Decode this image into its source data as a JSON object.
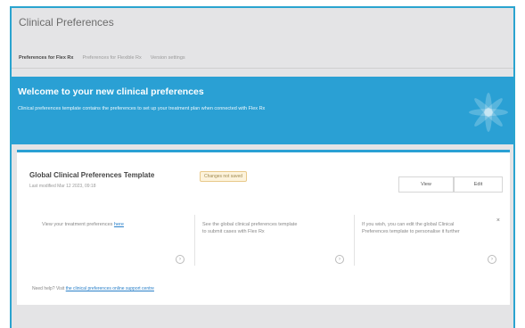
{
  "app": {
    "title": "Clinical Preferences"
  },
  "tabs": [
    {
      "label": "Preferences for Flex Rx",
      "active": true
    },
    {
      "label": "Preferences for Flexible Rx",
      "active": false
    },
    {
      "label": "Version settings",
      "active": false
    }
  ],
  "banner": {
    "title": "Welcome to your new clinical preferences",
    "subtitle": "Clinical preferences template contains the preferences to set up your treatment plan when connected with Flex Rx",
    "color": "#2aa0d4"
  },
  "card": {
    "title": "Global Clinical Preferences Template",
    "badge": "Changes not saved",
    "subtitle": "Last modified Mar 12 2023, 09:18",
    "buttons": {
      "view": "View",
      "edit": "Edit"
    },
    "info": [
      {
        "text": "View your treatment preferences",
        "link": "here",
        "arrow": "›"
      },
      {
        "text": "See the global clinical preferences template to submit cases with Flex Rx",
        "arrow": "›"
      },
      {
        "text": "If you wish, you can edit the global Clinical Preferences template to personalise it further",
        "dismiss": "×",
        "arrow": "›"
      }
    ],
    "footer": {
      "prefix": "Need help? Visit",
      "link": "the clinical preferences online support centre"
    }
  }
}
